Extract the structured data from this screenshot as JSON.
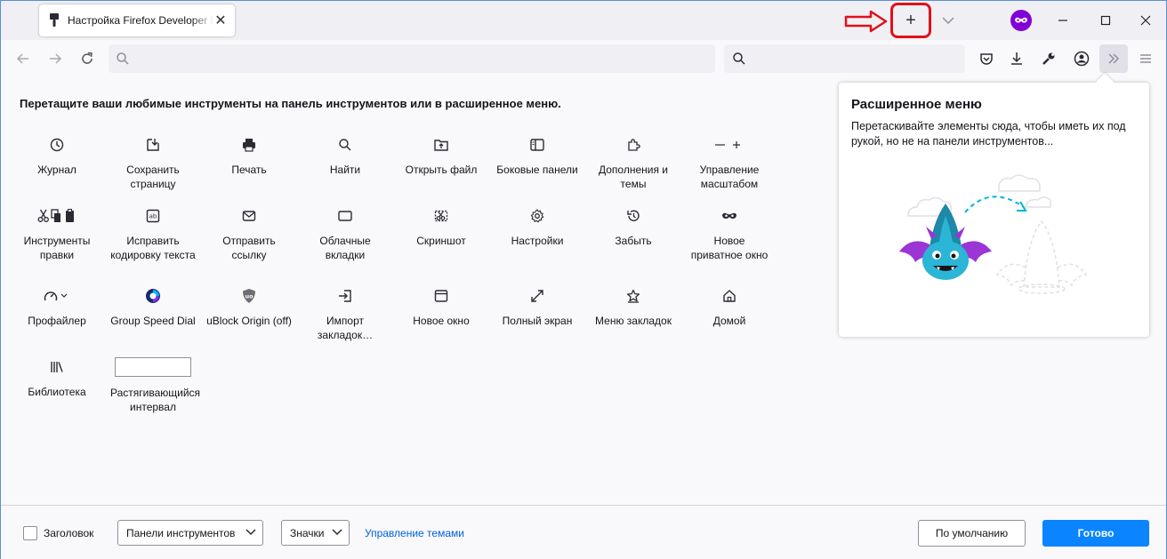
{
  "tab": {
    "title": "Настройка Firefox Developer Edition",
    "close": "✕"
  },
  "titlebar": {
    "new_tab": "+",
    "minimize": "—",
    "maximize": "□",
    "close": "✕"
  },
  "intro": "Перетащите ваши любимые инструменты на панель инструментов или в расширенное меню.",
  "palette": [
    {
      "label": "Журнал",
      "icon": "clock-icon"
    },
    {
      "label": "Сохранить страницу",
      "icon": "save-page-icon"
    },
    {
      "label": "Печать",
      "icon": "printer-icon"
    },
    {
      "label": "Найти",
      "icon": "search-icon"
    },
    {
      "label": "Открыть файл",
      "icon": "open-file-icon"
    },
    {
      "label": "Боковые панели",
      "icon": "sidebar-icon"
    },
    {
      "label": "Дополнения и темы",
      "icon": "puzzle-icon"
    },
    {
      "label": "Управление масштабом",
      "icon": "zoom-controls-icon"
    },
    {
      "label": "Инструменты правки",
      "icon": "edit-tools-icon"
    },
    {
      "label": "Исправить кодировку текста",
      "icon": "encoding-icon"
    },
    {
      "label": "Отправить ссылку",
      "icon": "email-icon"
    },
    {
      "label": "Облачные вкладки",
      "icon": "synced-tabs-icon"
    },
    {
      "label": "Скриншот",
      "icon": "screenshot-icon"
    },
    {
      "label": "Настройки",
      "icon": "gear-icon"
    },
    {
      "label": "Забыть",
      "icon": "forget-icon"
    },
    {
      "label": "Новое приватное окно",
      "icon": "private-mask-icon"
    },
    {
      "label": "Профайлер",
      "icon": "profiler-icon"
    },
    {
      "label": "Group Speed Dial",
      "icon": "group-speed-dial-icon"
    },
    {
      "label": "uBlock Origin (off)",
      "icon": "ublock-origin-icon"
    },
    {
      "label": "Импорт закладок…",
      "icon": "import-icon"
    },
    {
      "label": "Новое окно",
      "icon": "new-window-icon"
    },
    {
      "label": "Полный экран",
      "icon": "fullscreen-icon"
    },
    {
      "label": "Меню закладок",
      "icon": "bookmark-star-icon"
    },
    {
      "label": "Домой",
      "icon": "home-icon"
    },
    {
      "label": "Библиотека",
      "icon": "library-icon"
    },
    {
      "label": "Растягивающийся интервал",
      "icon": "flexible-space"
    }
  ],
  "overflow_panel": {
    "title": "Расширенное меню",
    "description": "Перетаскивайте элементы сюда, чтобы иметь их под рукой, но не на панели инструментов..."
  },
  "footer": {
    "title_checkbox_label": "Заголовок",
    "toolbars_select": "Панели инструментов",
    "density_select": "Значки",
    "manage_themes_link": "Управление темами",
    "restore_defaults": "По умолчанию",
    "done": "Готово"
  },
  "colors": {
    "accent": "#0a84ff",
    "annotation_red": "#e0111a",
    "link": "#0061e0"
  }
}
